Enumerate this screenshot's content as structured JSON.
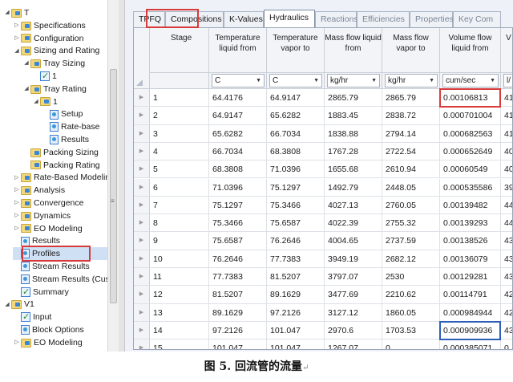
{
  "tree": {
    "items": [
      {
        "label": "T",
        "icon": "folder-icon",
        "twisty": "▲",
        "depth": 0
      },
      {
        "label": "Specifications",
        "icon": "folder-icon",
        "twisty": "▷",
        "depth": 1
      },
      {
        "label": "Configuration",
        "icon": "folder-icon",
        "twisty": "▷",
        "depth": 1
      },
      {
        "label": "Sizing and Rating",
        "icon": "folder-icon",
        "twisty": "▲",
        "depth": 1
      },
      {
        "label": "Tray Sizing",
        "icon": "folder-icon",
        "twisty": "▲",
        "depth": 2
      },
      {
        "label": "1",
        "icon": "checked-form-icon",
        "twisty": "",
        "depth": 3
      },
      {
        "label": "Tray Rating",
        "icon": "folder-icon",
        "twisty": "▲",
        "depth": 2
      },
      {
        "label": "1",
        "icon": "folder-icon",
        "twisty": "▲",
        "depth": 3
      },
      {
        "label": "Setup",
        "icon": "form-icon",
        "twisty": "",
        "depth": 4
      },
      {
        "label": "Rate-base",
        "icon": "form-icon",
        "twisty": "",
        "depth": 4
      },
      {
        "label": "Results",
        "icon": "form-icon",
        "twisty": "",
        "depth": 4
      },
      {
        "label": "Packing Sizing",
        "icon": "folder-icon",
        "twisty": "",
        "depth": 2
      },
      {
        "label": "Packing Rating",
        "icon": "folder-icon",
        "twisty": "",
        "depth": 2
      },
      {
        "label": "Rate-Based Modelin",
        "icon": "folder-icon",
        "twisty": "▷",
        "depth": 1
      },
      {
        "label": "Analysis",
        "icon": "folder-icon",
        "twisty": "▷",
        "depth": 1
      },
      {
        "label": "Convergence",
        "icon": "folder-icon",
        "twisty": "▷",
        "depth": 1
      },
      {
        "label": "Dynamics",
        "icon": "folder-icon",
        "twisty": "▷",
        "depth": 1
      },
      {
        "label": "EO Modeling",
        "icon": "folder-icon",
        "twisty": "▷",
        "depth": 1
      },
      {
        "label": "Results",
        "icon": "form-icon",
        "twisty": "",
        "depth": 1
      },
      {
        "label": "Profiles",
        "icon": "form-icon",
        "twisty": "",
        "depth": 1
      },
      {
        "label": "Stream Results",
        "icon": "form-icon",
        "twisty": "",
        "depth": 1
      },
      {
        "label": "Stream Results (Cus",
        "icon": "form-icon",
        "twisty": "",
        "depth": 1
      },
      {
        "label": "Summary",
        "icon": "checked-form-icon",
        "twisty": "",
        "depth": 1
      },
      {
        "label": "V1",
        "icon": "folder-icon",
        "twisty": "▲",
        "depth": 0
      },
      {
        "label": "Input",
        "icon": "checked-form-icon",
        "twisty": "",
        "depth": 1
      },
      {
        "label": "Block Options",
        "icon": "form-icon",
        "twisty": "",
        "depth": 1
      },
      {
        "label": "EO Modeling",
        "icon": "folder-icon",
        "twisty": "▷",
        "depth": 1
      }
    ],
    "selected": "Profiles"
  },
  "tabs": [
    "TPFQ",
    "Compositions",
    "K-Values",
    "Hydraulics",
    "Reactions",
    "Efficiencies",
    "Properties",
    "Key Com"
  ],
  "active_tab": "Hydraulics",
  "table": {
    "columns": [
      {
        "header": "Stage",
        "unit": ""
      },
      {
        "header": "Temperature liquid from",
        "unit": "C"
      },
      {
        "header": "Temperature vapor to",
        "unit": "C"
      },
      {
        "header": "Mass flow liquid from",
        "unit": "kg/hr"
      },
      {
        "header": "Mass flow vapor to",
        "unit": "kg/hr"
      },
      {
        "header": "Volume flow liquid from",
        "unit": "cum/sec"
      },
      {
        "header": "V",
        "unit": "l/"
      }
    ],
    "rows": [
      [
        "1",
        "64.4176",
        "64.9147",
        "2865.79",
        "2865.79",
        "0.00106813",
        "41"
      ],
      [
        "2",
        "64.9147",
        "65.6282",
        "1883.45",
        "2838.72",
        "0.000701004",
        "41"
      ],
      [
        "3",
        "65.6282",
        "66.7034",
        "1838.88",
        "2794.14",
        "0.000682563",
        "41"
      ],
      [
        "4",
        "66.7034",
        "68.3808",
        "1767.28",
        "2722.54",
        "0.000652649",
        "40"
      ],
      [
        "5",
        "68.3808",
        "71.0396",
        "1655.68",
        "2610.94",
        "0.00060549",
        "40"
      ],
      [
        "6",
        "71.0396",
        "75.1297",
        "1492.79",
        "2448.05",
        "0.000535586",
        "39"
      ],
      [
        "7",
        "75.1297",
        "75.3466",
        "4027.13",
        "2760.05",
        "0.00139482",
        "44"
      ],
      [
        "8",
        "75.3466",
        "75.6587",
        "4022.39",
        "2755.32",
        "0.00139293",
        "44"
      ],
      [
        "9",
        "75.6587",
        "76.2646",
        "4004.65",
        "2737.59",
        "0.00138526",
        "43"
      ],
      [
        "10",
        "76.2646",
        "77.7383",
        "3949.19",
        "2682.12",
        "0.00136079",
        "43"
      ],
      [
        "11",
        "77.7383",
        "81.5207",
        "3797.07",
        "2530",
        "0.00129281",
        "43"
      ],
      [
        "12",
        "81.5207",
        "89.1629",
        "3477.69",
        "2210.62",
        "0.00114791",
        "42"
      ],
      [
        "13",
        "89.1629",
        "97.2126",
        "3127.12",
        "1860.05",
        "0.000984944",
        "42"
      ],
      [
        "14",
        "97.2126",
        "101.047",
        "2970.6",
        "1703.53",
        "0.000909936",
        "43"
      ],
      [
        "15",
        "101.047",
        "101.047",
        "1267.07",
        "0",
        "0.000385071",
        "0"
      ]
    ],
    "highlight_red_cell": {
      "row": 0,
      "col": 5
    },
    "highlight_blue_cell": {
      "row": 13,
      "col": 5
    }
  },
  "caption": {
    "prefix": "图 5. ",
    "text": "回流管的流量",
    "mark": "↵"
  },
  "colors": {
    "highlight_red": "#d83a3a",
    "highlight_blue": "#2e5fb8",
    "selection": "#cfe0f5",
    "panel_bg": "#eef2f8"
  }
}
